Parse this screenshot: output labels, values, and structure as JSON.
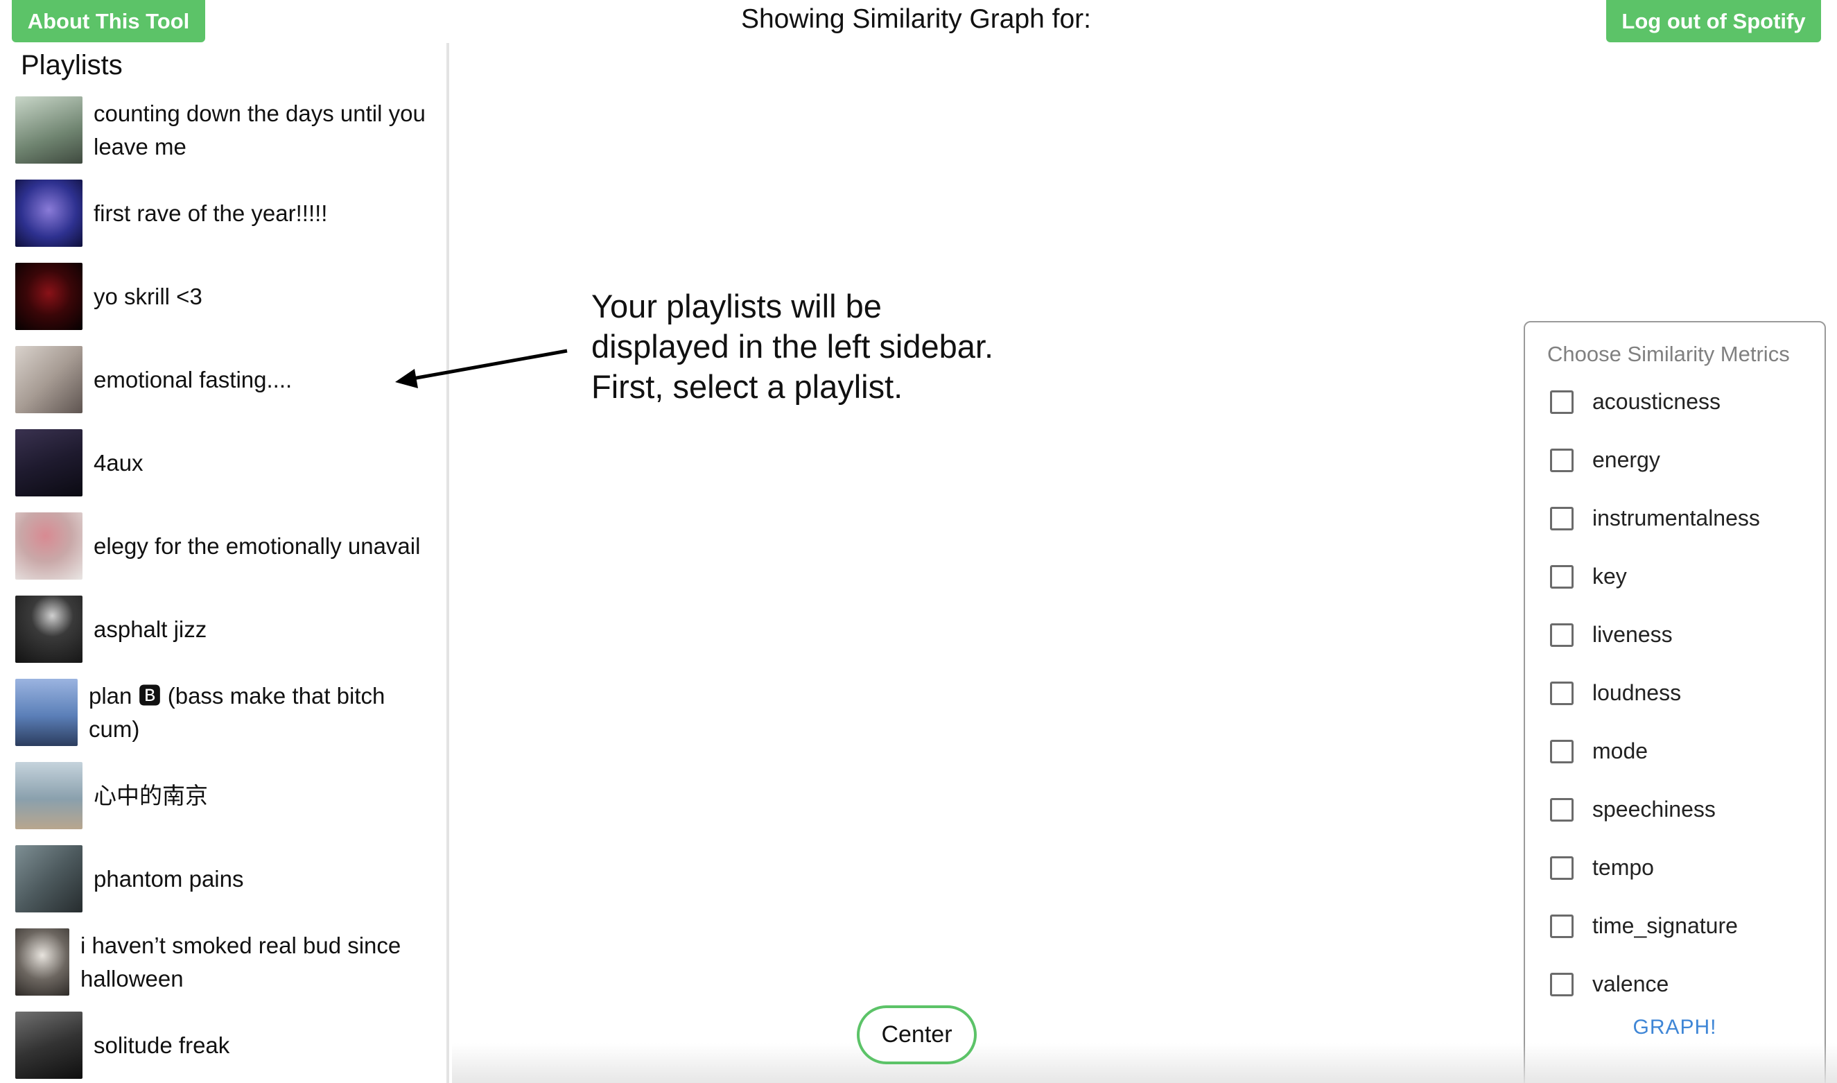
{
  "header": {
    "about_label": "About This Tool",
    "title": "Showing Similarity Graph for:",
    "logout_label": "Log out of Spotify"
  },
  "sidebar": {
    "title": "Playlists",
    "items": [
      {
        "label": "counting down the days until you leave me",
        "thumb_color": "#8b9a8c"
      },
      {
        "label": "first rave of the year!!!!!",
        "thumb_color": "#2e3190"
      },
      {
        "label": "yo skrill <3",
        "thumb_color": "#3a0608"
      },
      {
        "label": "emotional fasting....",
        "thumb_color": "#a79c94"
      },
      {
        "label": "4aux",
        "thumb_color": "#1e1a2e"
      },
      {
        "label": "elegy for the emotionally unavail",
        "thumb_color": "#c9a8a8"
      },
      {
        "label": "asphalt jizz",
        "thumb_color": "#262626"
      },
      {
        "label": "plan 🅱 (bass make that bitch cum)",
        "thumb_color": "#5b7fb8"
      },
      {
        "label": "心中的南京",
        "thumb_color": "#8aa0ad"
      },
      {
        "label": "phantom pains",
        "thumb_color": "#4d5a5e"
      },
      {
        "label": "i haven’t smoked real bud since halloween",
        "thumb_color": "#6c6660"
      },
      {
        "label": "solitude freak",
        "thumb_color": "#333333"
      }
    ]
  },
  "main": {
    "hint_lines": [
      "Your playlists will be",
      "displayed in the left sidebar.",
      "First, select a playlist."
    ],
    "center_label": "Center"
  },
  "metrics": {
    "title": "Choose Similarity Metrics",
    "options": [
      {
        "label": "acousticness",
        "checked": false
      },
      {
        "label": "energy",
        "checked": false
      },
      {
        "label": "instrumentalness",
        "checked": false
      },
      {
        "label": "key",
        "checked": false
      },
      {
        "label": "liveness",
        "checked": false
      },
      {
        "label": "loudness",
        "checked": false
      },
      {
        "label": "mode",
        "checked": false
      },
      {
        "label": "speechiness",
        "checked": false
      },
      {
        "label": "tempo",
        "checked": false
      },
      {
        "label": "time_signature",
        "checked": false
      },
      {
        "label": "valence",
        "checked": false
      }
    ],
    "graph_label": "GRAPH!"
  },
  "colors": {
    "accent_green": "#5cc368",
    "link_blue": "#3f86d6"
  }
}
